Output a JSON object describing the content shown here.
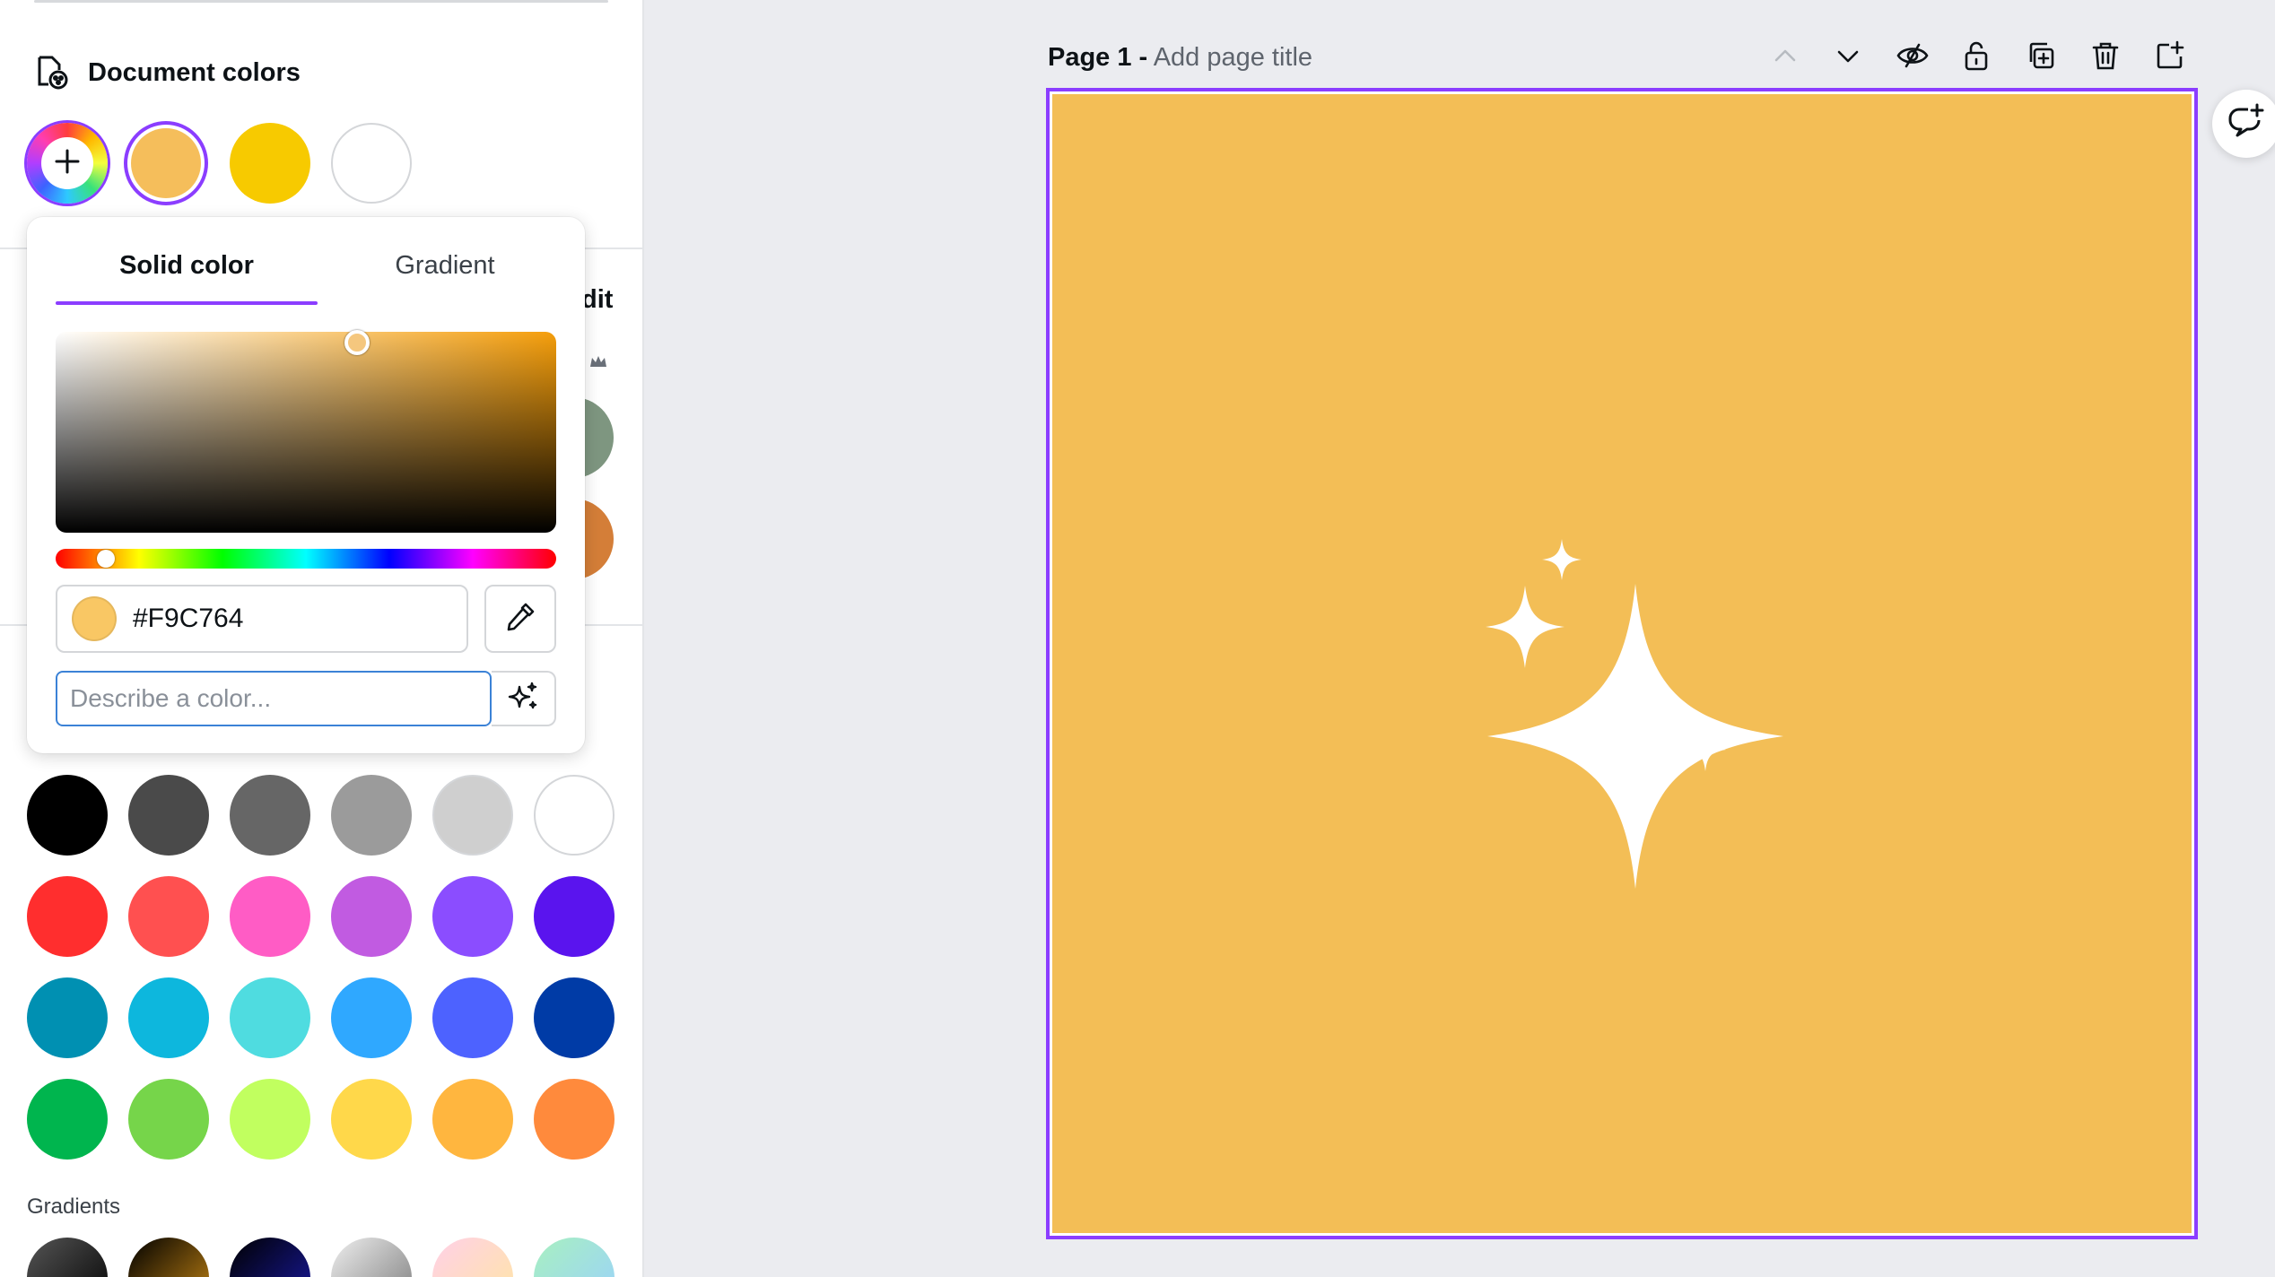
{
  "document_colors": {
    "title": "Document colors",
    "swatches": [
      "#F5BE5B",
      "#F7CA00",
      "#FFFFFF"
    ]
  },
  "partial_swatches": [
    "#7E9680",
    "#D47E38"
  ],
  "color_picker": {
    "tabs": [
      "Solid color",
      "Gradient"
    ],
    "active_tab": "Solid color",
    "hex_value": "#F9C764",
    "hue_fraction": 0.1,
    "describe_placeholder": "Describe a color..."
  },
  "hidden_panel_text": {
    "edit_fragment": "dit"
  },
  "default_colors": [
    [
      "#000000",
      "#4A4A4A",
      "#666666",
      "#9B9B9B",
      "#CFCFCF",
      "#FFFFFF"
    ],
    [
      "#FF2E2E",
      "#FF5050",
      "#FF5CC5",
      "#C15BE1",
      "#8B4DFF",
      "#5A14EE"
    ],
    [
      "#0090B2",
      "#0DB7DD",
      "#4FDCE0",
      "#2FA8FF",
      "#4D62FF",
      "#003BA6"
    ],
    [
      "#00B54E",
      "#76D54A",
      "#C1FF5F",
      "#FFD84A",
      "#FFB63F",
      "#FF8A3C"
    ]
  ],
  "gradients": {
    "label": "Gradients",
    "items": [
      "linear-gradient(135deg,#555,#000)",
      "linear-gradient(135deg,#000,#cc8a14)",
      "linear-gradient(135deg,#000,#1a1aa8)",
      "linear-gradient(135deg,#eee,#777)",
      "linear-gradient(135deg,#ffd0e8,#ffe7a0)",
      "linear-gradient(135deg,#a8f0c0,#9ad0ff)"
    ]
  },
  "canvas": {
    "page_number_label": "Page 1 -",
    "page_title_placeholder": "Add page title",
    "background": "#F3BE56",
    "accent": "#8B3DFF"
  },
  "toolbar_icons": [
    "chevron-up-icon",
    "chevron-down-icon",
    "hide-icon",
    "lock-icon",
    "duplicate-page-icon",
    "delete-icon",
    "add-page-icon"
  ]
}
